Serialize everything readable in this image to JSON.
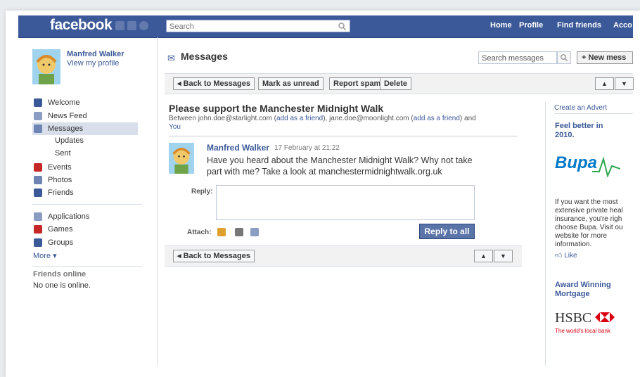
{
  "topbar": {
    "logo": "facebook",
    "search_placeholder": "Search",
    "nav": [
      "Home",
      "Profile",
      "Find friends",
      "Acco"
    ]
  },
  "profile": {
    "name": "Manfred Walker",
    "view_link": "View my profile"
  },
  "sidebar": {
    "items": [
      {
        "label": "Welcome",
        "icon": "facebook-f-icon",
        "color": "#3b5998"
      },
      {
        "label": "News Feed",
        "icon": "news-feed-icon",
        "color": "#8b9dc3"
      },
      {
        "label": "Messages",
        "icon": "message-icon",
        "color": "#6d84b4"
      },
      {
        "label": "Events",
        "icon": "calendar-icon",
        "color": "#c62828"
      },
      {
        "label": "Photos",
        "icon": "photo-icon",
        "color": "#6d84b4"
      },
      {
        "label": "Friends",
        "icon": "friends-icon",
        "color": "#3b5998"
      }
    ],
    "sub_items": [
      "Updates",
      "Sent"
    ],
    "apps": [
      {
        "label": "Applications",
        "icon": "applications-icon",
        "color": "#8b9dc3"
      },
      {
        "label": "Games",
        "icon": "games-icon",
        "color": "#c62828"
      },
      {
        "label": "Groups",
        "icon": "groups-icon",
        "color": "#3b5998"
      }
    ],
    "more": "More ▾",
    "friends_online_title": "Friends online",
    "friends_online_status": "No one is online."
  },
  "messages": {
    "title": "Messages",
    "search_placeholder": "Search messages",
    "new_message": "+ New mess",
    "toolbar": {
      "back": "◂ Back to Messages",
      "mark_unread": "Mark as unread",
      "report_spam": "Report spam",
      "delete": "Delete"
    }
  },
  "thread": {
    "title": "Please support the Manchester Midnight Walk",
    "meta_prefix": "Between john.doe@starlight.com (",
    "add_friend": "add as a friend",
    "meta_mid": "), jane.doe@moonlight.com (",
    "meta_suffix": ") and",
    "meta_you": "You",
    "message": {
      "author": "Manfred Walker",
      "date": "17 February at 21:22",
      "body": "Have you heard about the Manchester Midnight Walk? Why not take part with me? Take a look at manchestermidnightwalk.org.uk"
    },
    "reply_label": "Reply:",
    "attach_label": "Attach:",
    "reply_all": "Reply to all",
    "back_bottom": "◂ Back to Messages"
  },
  "ads": {
    "create_advert": "Create an Advert",
    "ad1": {
      "title": "Feel better in 2010.",
      "brand": "Bupa",
      "text": "If you want the most extensive private heal insurance, you're righ choose Bupa. Visit ou website for more information.",
      "like": "Like"
    },
    "ad2": {
      "title": "Award Winning Mortgage",
      "brand": "HSBC",
      "tagline": "The world's local bank"
    }
  }
}
